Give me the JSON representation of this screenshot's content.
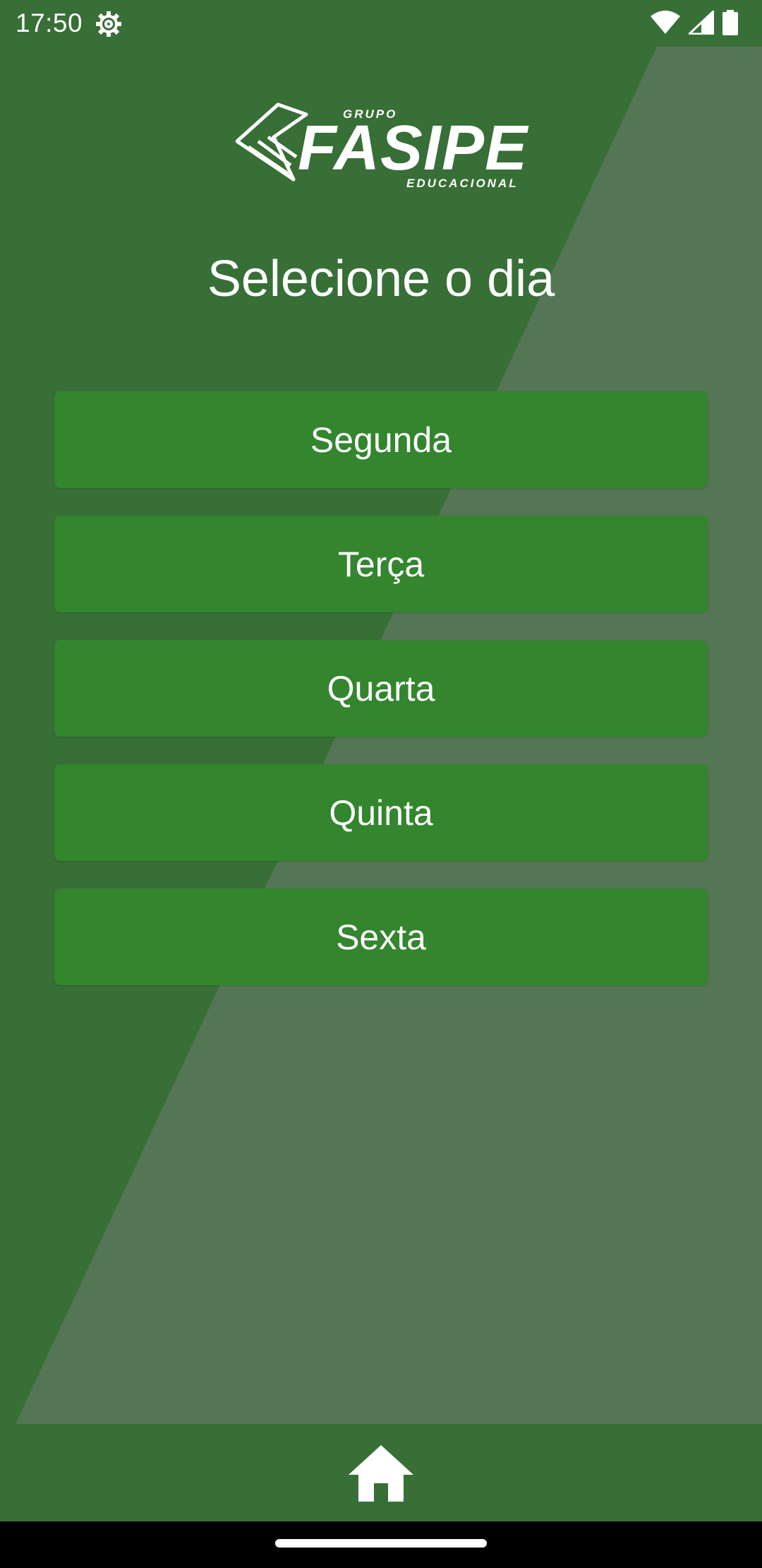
{
  "status_bar": {
    "time": "17:50",
    "icons": [
      "gear-icon",
      "wifi-icon",
      "cell-signal-icon",
      "battery-icon"
    ]
  },
  "logo": {
    "top_text": "GRUPO",
    "main_text": "FASIPE",
    "bottom_text": "EDUCACIONAL"
  },
  "page": {
    "title": "Selecione o dia"
  },
  "days": [
    {
      "label": "Segunda"
    },
    {
      "label": "Terça"
    },
    {
      "label": "Quarta"
    },
    {
      "label": "Quinta"
    },
    {
      "label": "Sexta"
    }
  ],
  "bottom_nav": {
    "icon": "home-icon"
  },
  "colors": {
    "background": "#376f36",
    "diagonal_panel": "#557654",
    "button": "#33852e",
    "text": "#ffffff"
  }
}
